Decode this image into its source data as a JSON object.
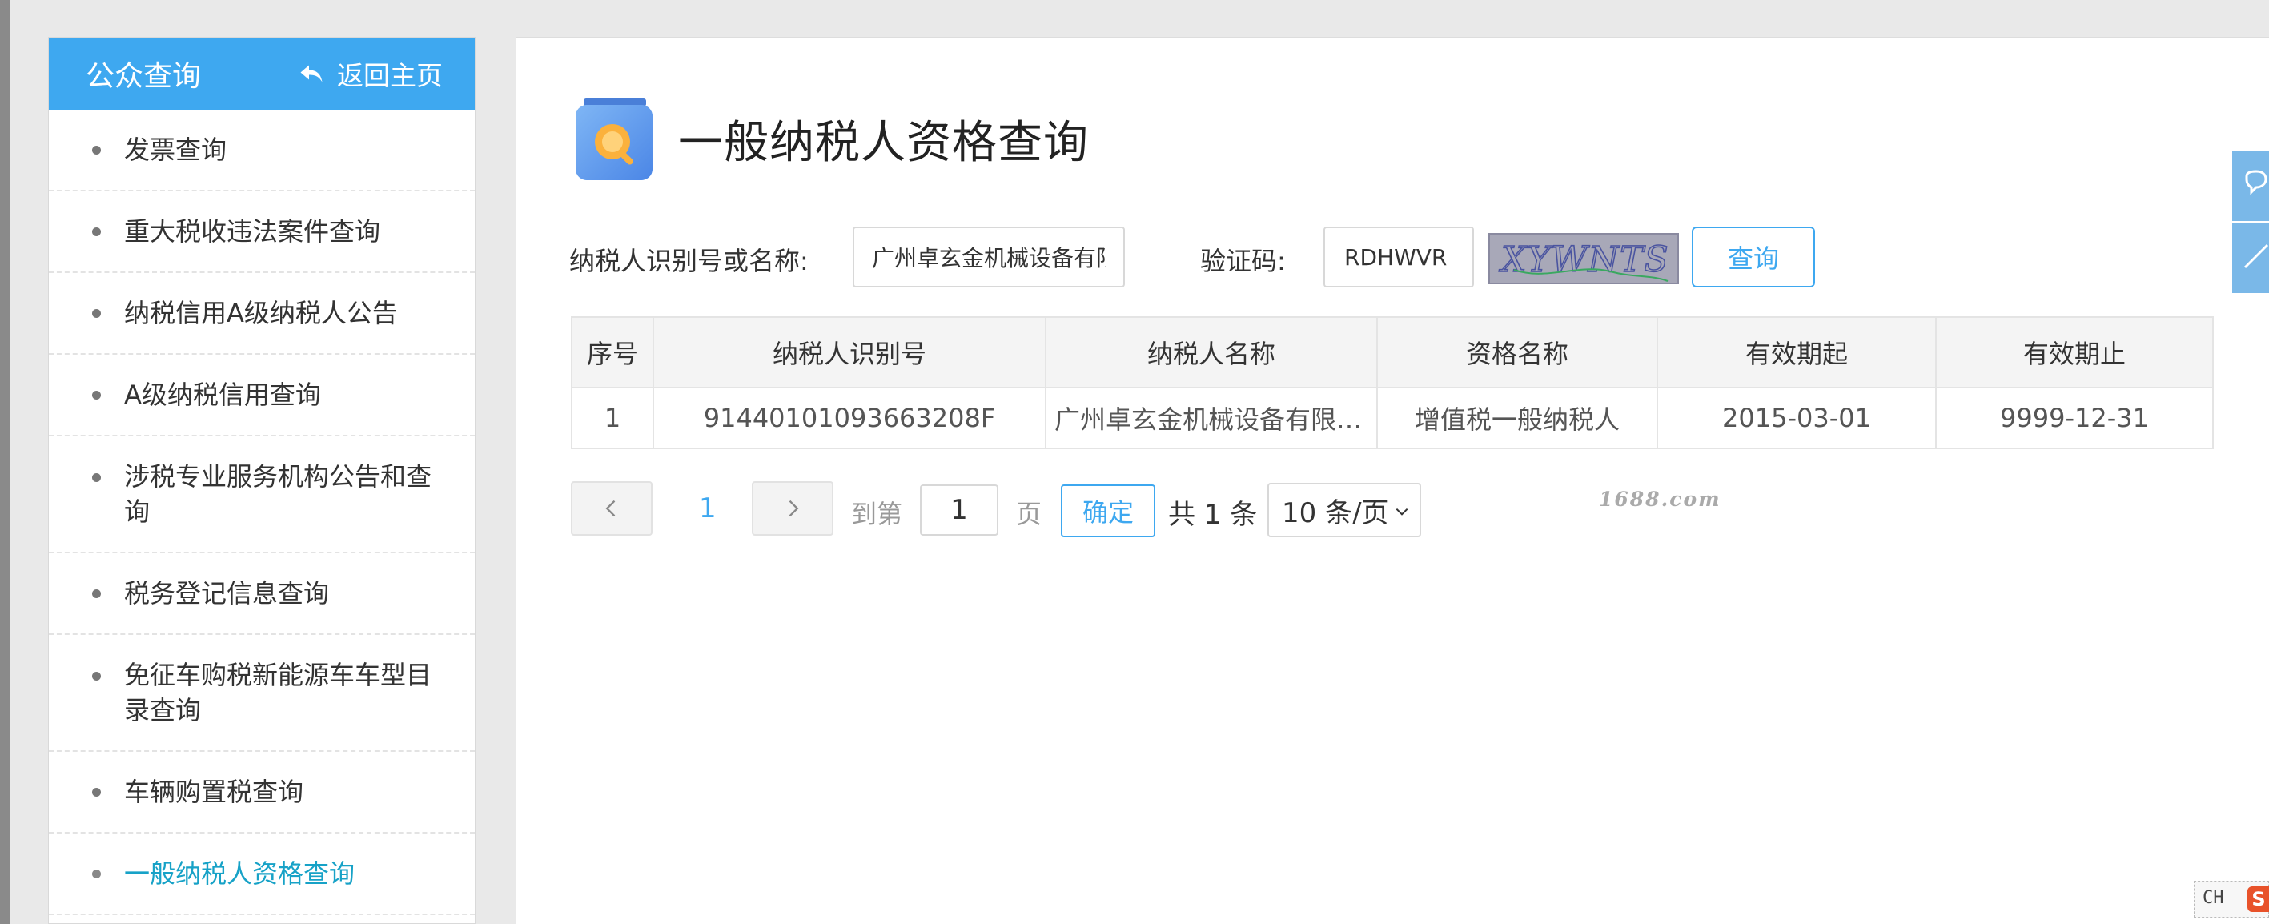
{
  "sidebar": {
    "title": "公众查询",
    "back_label": "返回主页",
    "items": [
      {
        "label": "发票查询"
      },
      {
        "label": "重大税收违法案件查询"
      },
      {
        "label": "纳税信用A级纳税人公告"
      },
      {
        "label": "A级纳税信用查询"
      },
      {
        "label": "涉税专业服务机构公告和查询"
      },
      {
        "label": "税务登记信息查询"
      },
      {
        "label": "免征车购税新能源车车型目录查询"
      },
      {
        "label": "车辆购置税查询"
      },
      {
        "label": "一般纳税人资格查询",
        "active": true
      }
    ]
  },
  "page": {
    "title": "一般纳税人资格查询"
  },
  "search": {
    "taxpayer_label": "纳税人识别号或名称:",
    "taxpayer_value": "广州卓玄金机械设备有限公司",
    "captcha_label": "验证码:",
    "captcha_value": "RDHWVR",
    "captcha_image_text": "XYWNTS",
    "query_button": "查询"
  },
  "table": {
    "headers": [
      "序号",
      "纳税人识别号",
      "纳税人名称",
      "资格名称",
      "有效期起",
      "有效期止"
    ],
    "rows": [
      [
        "1",
        "91440101093663208F",
        "广州卓玄金机械设备有限公司",
        "增值税一般纳税人",
        "2015-03-01",
        "9999-12-31"
      ]
    ]
  },
  "pagination": {
    "current_page": "1",
    "goto_label": "到第",
    "goto_value": "1",
    "page_unit": "页",
    "confirm_label": "确定",
    "total_label": "共 1 条",
    "page_size": "10 条/页"
  },
  "watermark": "1688.com",
  "ime": {
    "label": "CH",
    "logo": "S"
  },
  "colors": {
    "accent": "#3ea8f0",
    "active_item": "#17a2c7"
  }
}
